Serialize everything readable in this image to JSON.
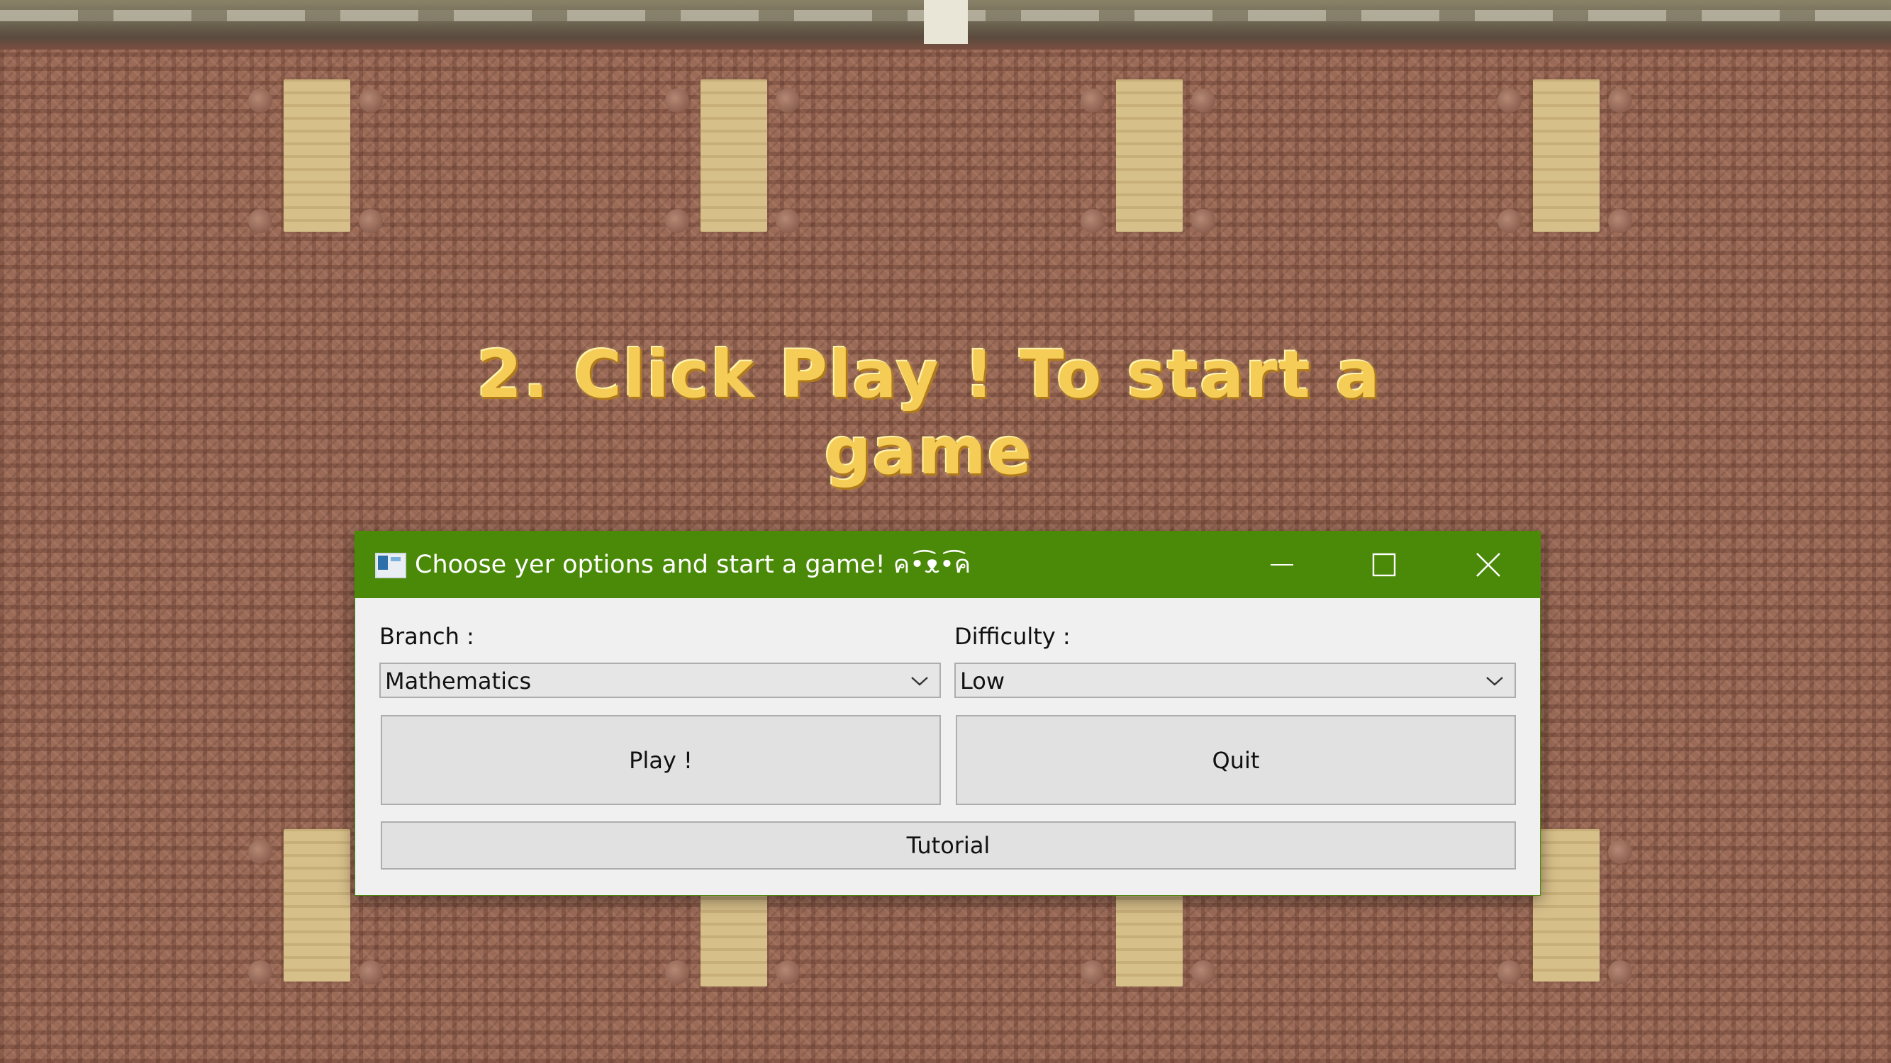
{
  "background": {
    "headline": "2. Click Play ! To start a game",
    "accent_color": "#f5cc55",
    "wall_color": "#9b6b58"
  },
  "window": {
    "title": "Choose yer options and start a game! ค•͡ᴥ•͡ค",
    "titlebar_color": "#4a8a08",
    "icon": "app-window-icon",
    "controls": {
      "minimize_icon": "minimize-icon",
      "maximize_icon": "maximize-icon",
      "close_icon": "close-icon"
    }
  },
  "form": {
    "branch_label": "Branch :",
    "branch_value": "Mathematics",
    "difficulty_label": "Difficulty :",
    "difficulty_value": "Low",
    "play_label": "Play !",
    "quit_label": "Quit",
    "tutorial_label": "Tutorial"
  }
}
